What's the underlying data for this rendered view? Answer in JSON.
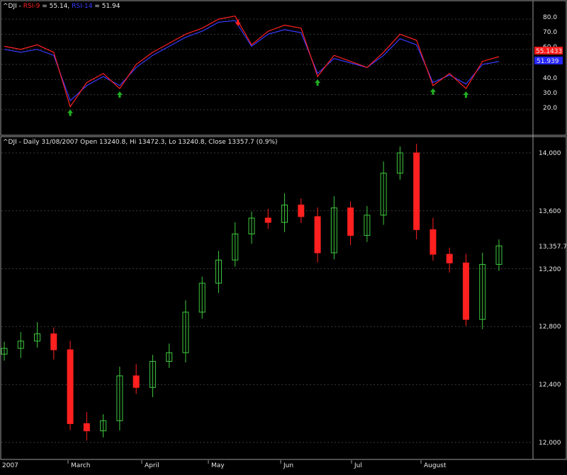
{
  "rsi_panel": {
    "ticker": "^DJI",
    "sep": " - ",
    "rsi9_label": "RSI-9",
    "rsi9_value": "55.14",
    "rsi14_label": "RSI-14",
    "rsi14_value": "51.94",
    "eq": " = ",
    "comma": ", ",
    "ticks": [
      "80.0",
      "70.0",
      "60.0",
      "50.0",
      "40.0",
      "30.0",
      "20.0"
    ],
    "rsi9_badge": "55.1433",
    "rsi14_badge": "51.939"
  },
  "price_panel": {
    "header": "^DJI - Daily 31/08/2007 Open 13240.8, Hi 13472.3, Lo 13240.8, Close 13357.7 (0.9%)",
    "ticks": [
      "14,000",
      "13,600",
      "13,200",
      "12,800",
      "12,400",
      "12,000"
    ],
    "last_label": "13,357.7"
  },
  "x_axis": [
    "2007",
    "March",
    "April",
    "May",
    "Jun",
    "Jul",
    "August"
  ],
  "colors": {
    "up": "#3ec83e",
    "down": "#ff2020",
    "rsi9": "#ff2020",
    "rsi14": "#3a3aff",
    "grid": "#3a3a3a",
    "frame": "#9a9a9a",
    "buy_arrow": "#22b022",
    "sell_arrow": "#ff2020"
  },
  "chart_data": [
    {
      "type": "line",
      "x": [
        "2007-02-01",
        "2007-02-08",
        "2007-02-15",
        "2007-02-22",
        "2007-03-01",
        "2007-03-08",
        "2007-03-15",
        "2007-03-22",
        "2007-03-29",
        "2007-04-05",
        "2007-04-12",
        "2007-04-19",
        "2007-04-26",
        "2007-05-03",
        "2007-05-10",
        "2007-05-17",
        "2007-05-24",
        "2007-05-31",
        "2007-06-07",
        "2007-06-14",
        "2007-06-21",
        "2007-06-28",
        "2007-07-05",
        "2007-07-12",
        "2007-07-19",
        "2007-07-26",
        "2007-08-02",
        "2007-08-09",
        "2007-08-16",
        "2007-08-23",
        "2007-08-31"
      ],
      "series": [
        {
          "name": "RSI-9",
          "values": [
            62,
            60,
            63,
            58,
            22,
            38,
            44,
            34,
            50,
            58,
            64,
            70,
            74,
            80,
            82,
            63,
            72,
            76,
            74,
            42,
            56,
            52,
            48,
            58,
            70,
            66,
            36,
            44,
            34,
            52,
            55.14
          ]
        },
        {
          "name": "RSI-14",
          "values": [
            60,
            58,
            60,
            56,
            26,
            36,
            42,
            36,
            48,
            56,
            62,
            68,
            72,
            78,
            79,
            62,
            70,
            73,
            71,
            44,
            54,
            51,
            48,
            56,
            67,
            63,
            38,
            43,
            37,
            50,
            51.94
          ]
        }
      ],
      "ylim": [
        15,
        90
      ]
    },
    {
      "type": "line",
      "x": [
        "2007-02-01",
        "2007-02-08",
        "2007-02-15",
        "2007-02-22",
        "2007-03-01",
        "2007-03-08",
        "2007-03-15",
        "2007-03-22",
        "2007-03-29",
        "2007-04-05",
        "2007-04-12",
        "2007-04-19",
        "2007-04-26",
        "2007-05-03",
        "2007-05-10",
        "2007-05-17",
        "2007-05-24",
        "2007-05-31",
        "2007-06-07",
        "2007-06-14",
        "2007-06-21",
        "2007-06-28",
        "2007-07-05",
        "2007-07-12",
        "2007-07-19",
        "2007-07-26",
        "2007-08-02",
        "2007-08-09",
        "2007-08-16",
        "2007-08-23",
        "2007-08-31"
      ],
      "series": [
        {
          "name": "Close",
          "values": [
            12650,
            12700,
            12750,
            12640,
            12130,
            12080,
            12150,
            12460,
            12380,
            12560,
            12620,
            12900,
            13100,
            13260,
            13440,
            13550,
            13520,
            13640,
            13560,
            13310,
            13620,
            13430,
            13570,
            13860,
            14000,
            13470,
            13300,
            13240,
            12850,
            13230,
            13357.7
          ]
        }
      ],
      "ylim": [
        11950,
        14150
      ]
    }
  ]
}
